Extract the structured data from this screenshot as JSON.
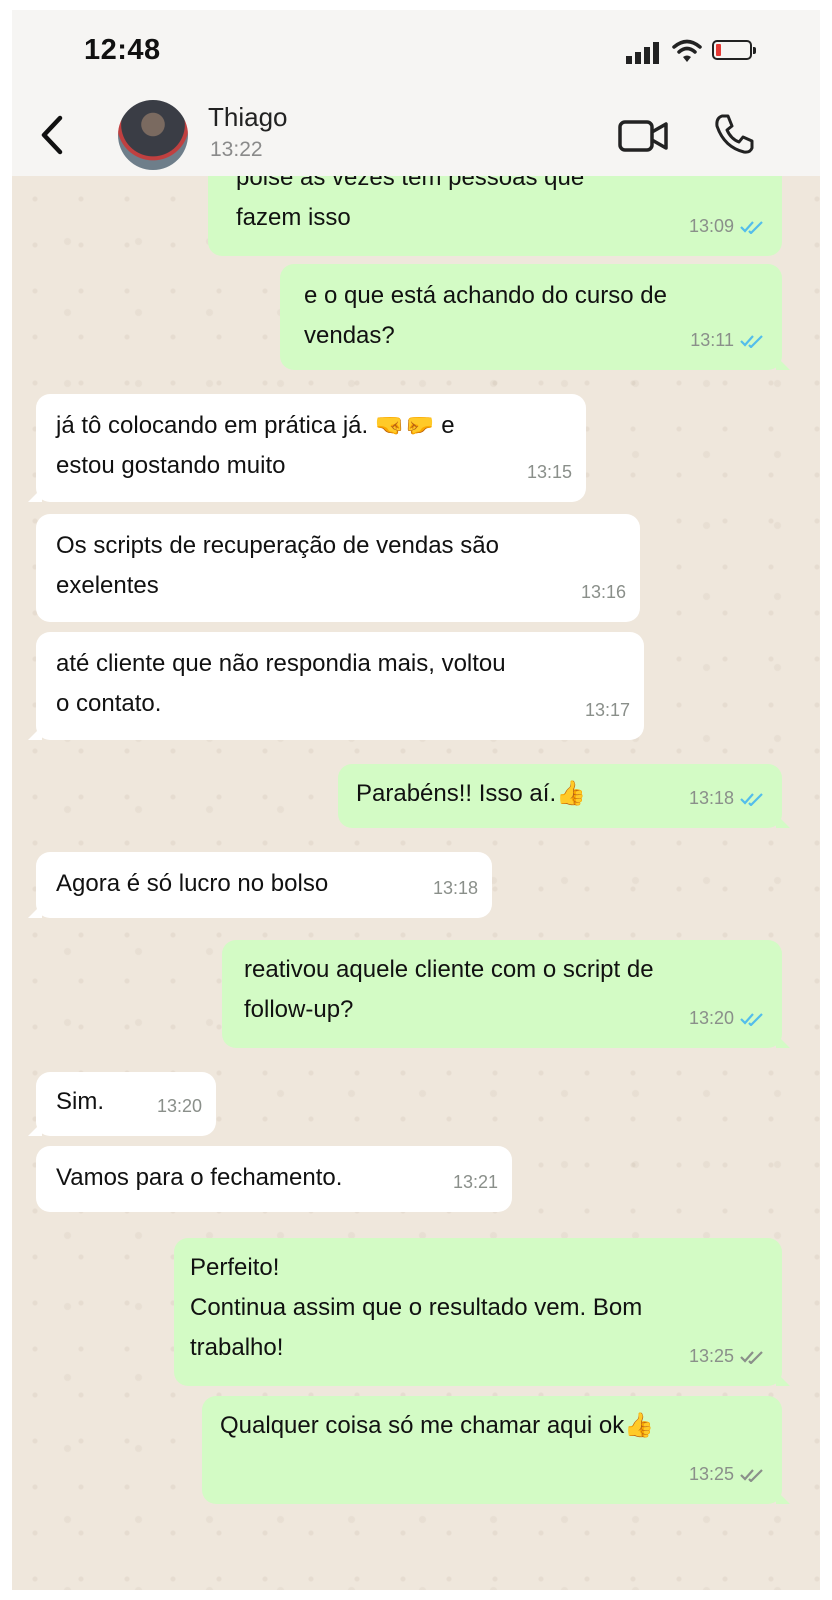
{
  "status_bar": {
    "time": "12:48"
  },
  "header": {
    "contact_name": "Thiago",
    "contact_status": "13:22"
  },
  "messages": [
    {
      "direction": "out",
      "text": "poise às vezes tem pessoas que\nfazem isso",
      "time": "13:09",
      "read": true
    },
    {
      "direction": "out",
      "text": "e o que está achando do curso de\nvendas?",
      "time": "13:11",
      "read": true
    },
    {
      "direction": "in",
      "text": "já tô colocando em prática já. 🤜🤛 e\nestou gostando muito",
      "time": "13:15"
    },
    {
      "direction": "in",
      "text": "Os scripts de recuperação de vendas são\nexelentes",
      "time": "13:16"
    },
    {
      "direction": "in",
      "text": "até cliente que não respondia mais, voltou\no contato.",
      "time": "13:17"
    },
    {
      "direction": "out",
      "text": "Parabéns!! Isso aí.👍",
      "time": "13:18",
      "read": true
    },
    {
      "direction": "in",
      "text": "Agora é só lucro no bolso",
      "time": "13:18"
    },
    {
      "direction": "out",
      "text": "reativou aquele cliente com o script de\nfollow-up?",
      "time": "13:20",
      "read": true
    },
    {
      "direction": "in",
      "text": "Sim.",
      "time": "13:20"
    },
    {
      "direction": "in",
      "text": "Vamos para o fechamento.",
      "time": "13:21"
    },
    {
      "direction": "out",
      "text": "Perfeito!\nContinua assim que o resultado vem. Bom\ntrabalho!",
      "time": "13:25",
      "read": false
    },
    {
      "direction": "out",
      "text": "Qualquer coisa só me chamar aqui ok👍",
      "time": "13:25",
      "read": false
    }
  ],
  "colors": {
    "read_tick": "#53bdeb",
    "delivered_tick": "#8a8f8a",
    "outgoing_bubble": "#d3fbc5",
    "incoming_bubble": "#ffffff",
    "battery_low": "#e53935"
  }
}
